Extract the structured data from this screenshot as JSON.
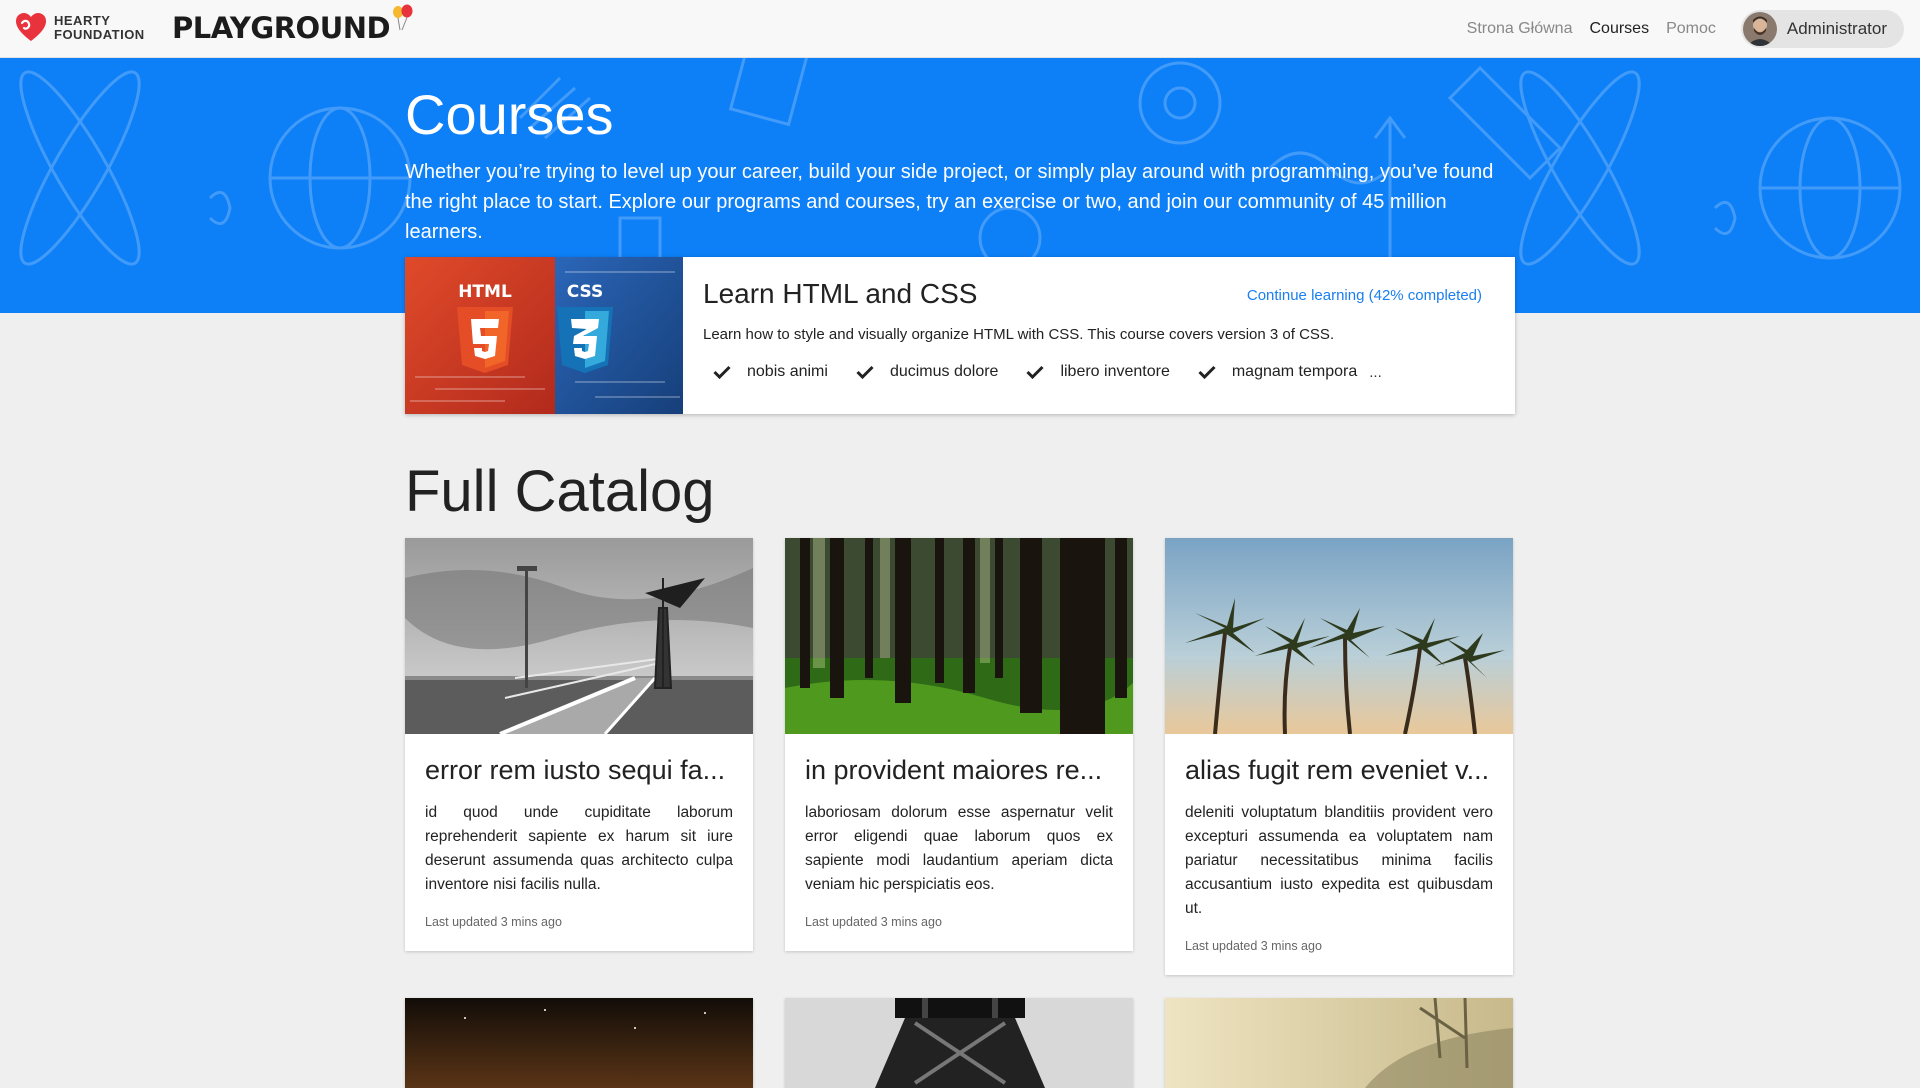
{
  "brand": {
    "org_line1": "HEARTY",
    "org_line2": "FOUNDATION",
    "app_name": "PLAYGROUND"
  },
  "nav": {
    "links": [
      {
        "label": "Strona Główna"
      },
      {
        "label": "Courses"
      },
      {
        "label": "Pomoc"
      }
    ],
    "user": "Administrator"
  },
  "hero": {
    "title": "Courses",
    "description": "Whether you’re trying to level up your career, build your side project, or simply play around with programming, you’ve found the right place to start. Explore our programs and courses, try an exercise or two, and join our community of 45 million learners."
  },
  "featured": {
    "title": "Learn HTML and CSS",
    "link": "Continue learning (42% completed)",
    "progress_percent": 42,
    "description": "Learn how to style and visually organize HTML with CSS. This course covers version 3 of CSS.",
    "tags": [
      "nobis animi",
      "ducimus dolore",
      "libero inventore",
      "magnam tempora"
    ],
    "more": "...",
    "badge_html": "HTML",
    "badge_css": "CSS"
  },
  "catalog": {
    "title": "Full Catalog",
    "cards": [
      {
        "title": "error rem iusto sequi fa...",
        "text": "id quod unde cupiditate laborum reprehenderit sapiente ex harum sit iure deserunt assumenda quas architecto culpa inventore nisi facilis nulla.",
        "meta": "Last updated 3 mins ago"
      },
      {
        "title": "in provident maiores re...",
        "text": "laboriosam dolorum esse aspernatur velit error eligendi quae laborum quos ex sapiente modi laudantium aperiam dicta veniam hic perspiciatis eos.",
        "meta": "Last updated 3 mins ago"
      },
      {
        "title": "alias fugit rem eveniet v...",
        "text": "deleniti voluptatum blanditiis provident vero excepturi assumenda ea voluptatem nam pariatur necessitatibus minima facilis accusantium iusto expedita est quibusdam ut.",
        "meta": "Last updated 3 mins ago"
      }
    ]
  },
  "colors": {
    "hero_blue": "#0d7ff7",
    "link_blue": "#1a7ff0",
    "brand_red": "#e8333c"
  }
}
